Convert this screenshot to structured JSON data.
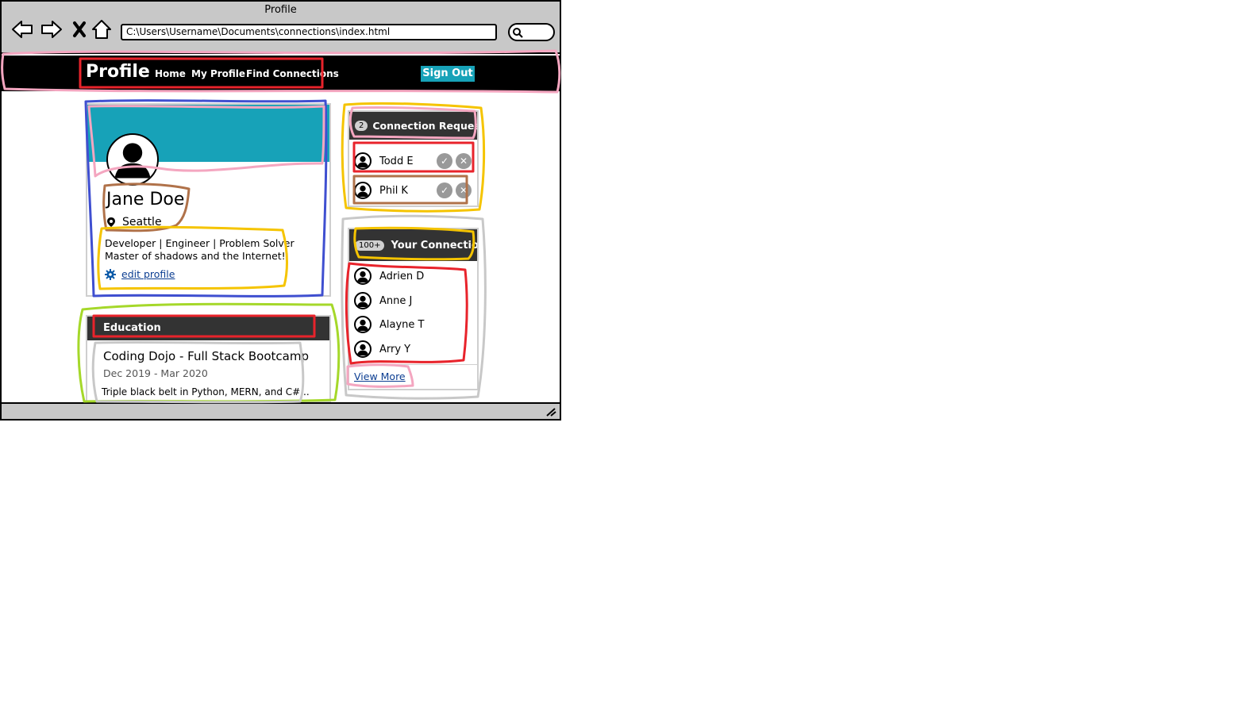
{
  "window": {
    "title": "Profile"
  },
  "browser": {
    "url": "C:\\Users\\Username\\Documents\\connections\\index.html",
    "search_value": "",
    "icons": [
      "back-arrow-icon",
      "forward-arrow-icon",
      "close-x-icon",
      "home-icon",
      "search-icon"
    ]
  },
  "navbar": {
    "brand": "Profile",
    "links": [
      "Home",
      "My Profile",
      "Find Connections"
    ],
    "signout_label": "Sign Out"
  },
  "profile": {
    "name": "Jane Doe",
    "location": "Seattle",
    "bio_line1": "Developer | Engineer | Problem Solver",
    "bio_line2": "Master of shadows and the Internet!",
    "edit_label": "edit profile"
  },
  "education": {
    "header": "Education",
    "items": [
      {
        "title": "Coding Dojo - Full Stack Bootcamp",
        "dates": "Dec 2019 - Mar 2020",
        "description": "Triple black belt in Python, MERN, and C#..."
      }
    ]
  },
  "requests": {
    "count": "2",
    "header": "Connection Requests",
    "items": [
      {
        "name": "Todd E"
      },
      {
        "name": "Phil K"
      }
    ]
  },
  "connections": {
    "count": "100+",
    "header": "Your Connections",
    "items": [
      {
        "name": "Adrien D"
      },
      {
        "name": "Anne J"
      },
      {
        "name": "Alayne T"
      },
      {
        "name": "Arry Y"
      }
    ],
    "view_more_label": "View More"
  },
  "colors": {
    "accent": "#17a2b8",
    "navbar_bg": "#000000",
    "card_header_bg": "#333333",
    "chrome_bg": "#c8c8c8",
    "link": "#0b3d91"
  }
}
